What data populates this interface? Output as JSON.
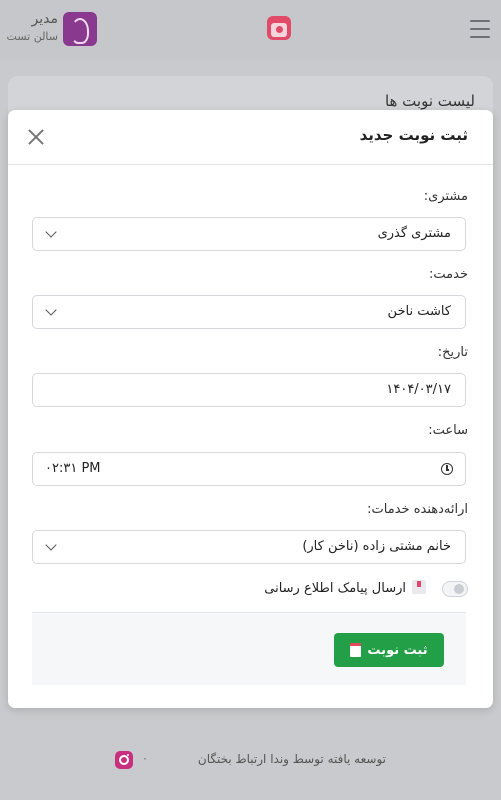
{
  "header": {
    "user_role": "مدیر",
    "salon_name": "سالن تست"
  },
  "background_card": {
    "title": "لیست نوبت ها"
  },
  "modal": {
    "title": "ثبت نوبت جدید",
    "fields": {
      "customer": {
        "label": "مشتری:",
        "value": "مشتری گذری"
      },
      "service": {
        "label": "خدمت:",
        "value": "کاشت ناخن"
      },
      "date": {
        "label": "تاریخ:",
        "value": "۱۴۰۴/۰۳/۱۷"
      },
      "time": {
        "label": "ساعت:",
        "value": "۰۲:۳۱ PM"
      },
      "provider": {
        "label": "ارائه‌دهنده خدمات:",
        "value": "خانم مشتی زاده (ناخن کار)"
      }
    },
    "sms_toggle": {
      "label": "ارسال پیامک اطلاع رسانی",
      "enabled": false
    },
    "submit_label": "ثبت نوبت"
  },
  "footer": {
    "credit": "توسعه یافته توسط وندا ارتباط بختگان",
    "separator": "·"
  },
  "colors": {
    "accent_green": "#23a047",
    "brand_pink": "#e14b68",
    "instagram": "#c8307f"
  }
}
